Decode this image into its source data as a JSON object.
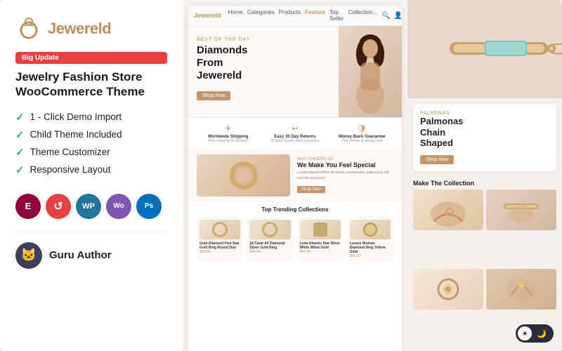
{
  "badge": {
    "label": "Big Update"
  },
  "logo": {
    "text_j": "J",
    "text_rest": "ewereld",
    "icon_alt": "Jewereld logo ring icon"
  },
  "theme": {
    "title_line1": "Jewelry Fashion Store",
    "title_line2": "WooCommerce Theme"
  },
  "features": [
    "1 - Click Demo Import",
    "Child Theme Included",
    "Theme Customizer",
    "Responsive Layout"
  ],
  "tech_badges": [
    {
      "label": "E",
      "class": "badge-e",
      "title": "Elementor"
    },
    {
      "label": "↺",
      "class": "badge-r",
      "title": "Revolution Slider"
    },
    {
      "label": "W",
      "class": "badge-wp",
      "title": "WordPress"
    },
    {
      "label": "Wo",
      "class": "badge-woo",
      "title": "WooCommerce"
    },
    {
      "label": "Ps",
      "class": "badge-ps",
      "title": "Photoshop"
    }
  ],
  "author": {
    "label": "Guru Author",
    "icon": "🐱"
  },
  "mockup": {
    "brand": "Jewereld",
    "nav_items": [
      "Home",
      "Categories",
      "Products",
      "Feature",
      "Top Seller",
      "Collection..."
    ],
    "hero": {
      "small_label": "Best Of The Day",
      "title_line1": "Diamonds",
      "title_line2": "From",
      "title_line3": "Jewereld",
      "cta": "Shop Now"
    },
    "features_row": [
      {
        "icon": "✈",
        "label": "Worldwide Shipping",
        "desc": "Free shipping on all order"
      },
      {
        "icon": "↩",
        "label": "Easy 30 Day Returns",
        "desc": "30 days money back guarantee"
      },
      {
        "icon": "🛡",
        "label": "Money Back Guarantee",
        "desc": "Your money is always safe"
      }
    ],
    "collection": {
      "label": "Why Choose Us",
      "title": "We Make You Feel Special",
      "desc": "Lorem ipsum dolor sit amet consectetur adipiscing elit sed do eiusmod.",
      "cta": "Shop Now"
    },
    "trending": {
      "title": "Top Trending Collections",
      "items": [
        {
          "name": "Gold Diamond Five Star Gold Ring Round Duo",
          "price": "$29.00"
        },
        {
          "name": "18 Carat All Diamond Silver Gold Ring",
          "price": "$34.00"
        },
        {
          "name": "Luna Atlantis Star Silver White White Gold",
          "price": "$45.00"
        },
        {
          "name": "Luxury Woman Diamond Ring Yellow Gold",
          "price": "$55.00"
        }
      ]
    }
  },
  "right_panel": {
    "card": {
      "label": "Palmonas",
      "title_line1": "Palmonas",
      "title_line2": "Chain",
      "title_line3": "Shaped",
      "cta": "Shop Now"
    },
    "collection_title": "Make The Collection",
    "toggle": {
      "light_icon": "☀",
      "dark_icon": "🌙"
    }
  }
}
